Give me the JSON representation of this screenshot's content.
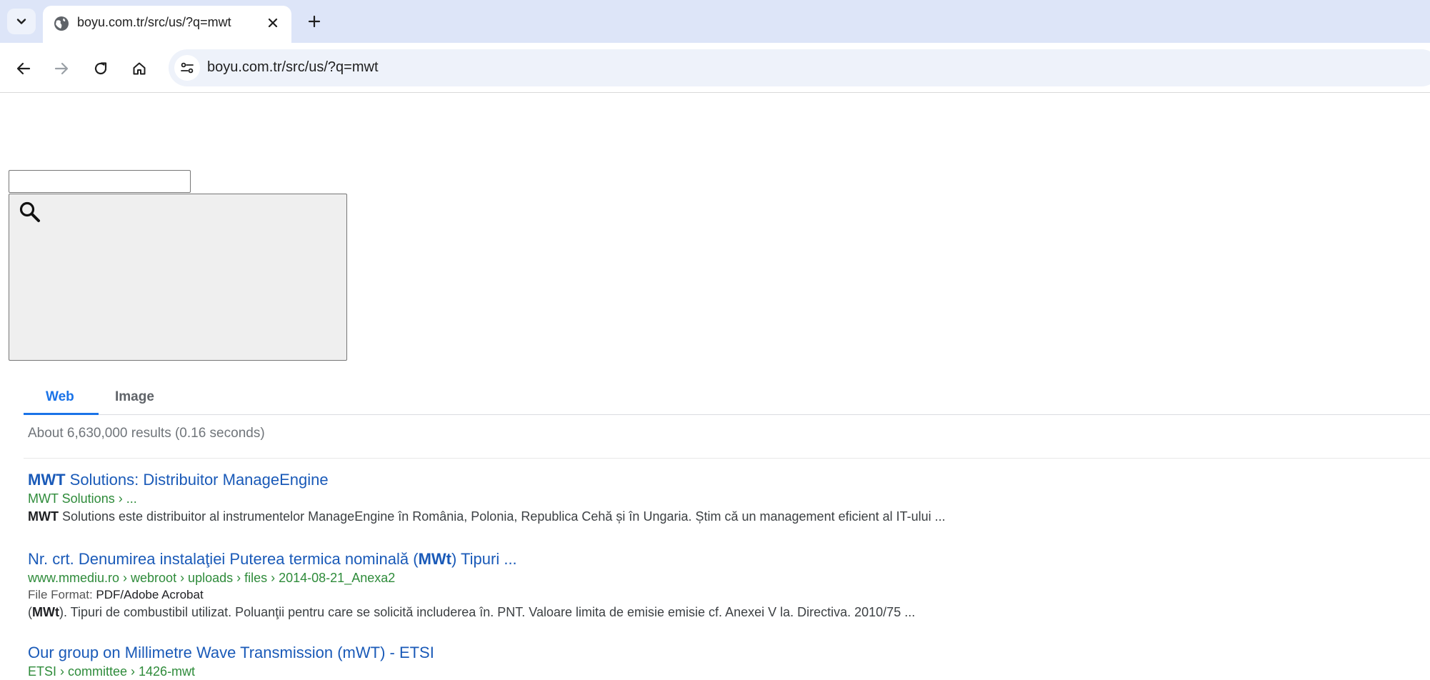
{
  "browser": {
    "tab_title": "boyu.com.tr/src/us/?q=mwt",
    "url": "boyu.com.tr/src/us/?q=mwt"
  },
  "search": {
    "query": "",
    "button_icon": "search-icon"
  },
  "tabs": [
    {
      "label": "Web",
      "active": true
    },
    {
      "label": "Image",
      "active": false
    }
  ],
  "stats": "About 6,630,000 results (0.16 seconds)",
  "results": [
    {
      "title_bold": "MWT",
      "title_rest": " Solutions: Distribuitor ManageEngine",
      "url": "MWT Solutions › ...",
      "snippet_bold": "MWT",
      "snippet_rest": " Solutions este distribuitor al instrumentelor ManageEngine în România, Polonia, Republica Cehă și în Ungaria. Știm că un management eficient al IT-ului ..."
    },
    {
      "title_pre": "Nr. crt. Denumirea instalaţiei Puterea termica nominală (",
      "title_bold": "MWt",
      "title_post": ") Tipuri ...",
      "url": "www.mmediu.ro › webroot › uploads › files › 2014-08-21_Anexa2",
      "file_format_label": "File Format:",
      "file_format_value": "PDF/Adobe Acrobat",
      "snippet_pre": "(",
      "snippet_bold": "MWt",
      "snippet_rest": "). Tipuri de combustibil utilizat. Poluanţii pentru care se solicită includerea în. PNT. Valoare limita de emisie emisie cf. Anexei V la. Directiva. 2010/75 ..."
    },
    {
      "title": "Our group on Millimetre Wave Transmission (mWT) - ETSI",
      "url": "ETSI › committee › 1426-mwt"
    }
  ]
}
